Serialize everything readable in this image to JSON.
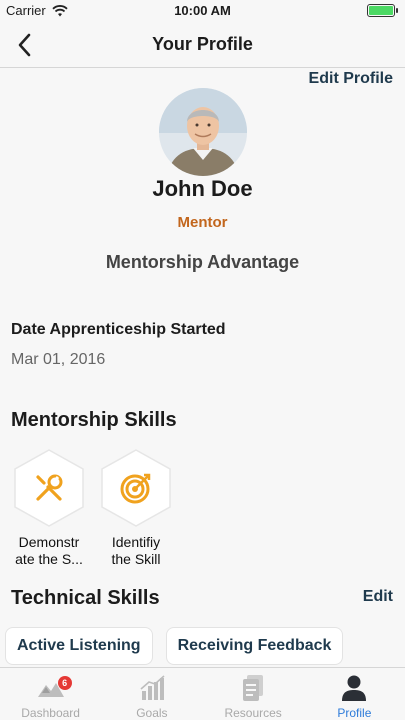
{
  "status_bar": {
    "carrier": "Carrier",
    "time": "10:00 AM",
    "battery_level": 1.0
  },
  "nav": {
    "title": "Your Profile",
    "back_icon": "chevron-left-icon"
  },
  "profile": {
    "edit_label": "Edit Profile",
    "name": "John Doe",
    "role": "Mentor",
    "subtitle": "Mentorship Advantage",
    "date_label": "Date Apprenticeship Started",
    "date_value": "Mar 01, 2016"
  },
  "mentorship_skills": {
    "title": "Mentorship Skills",
    "items": [
      {
        "label_line1": "Demonstr",
        "label_line2": "ate the S...",
        "icon": "tools-icon"
      },
      {
        "label_line1": "Identifiy",
        "label_line2": "the Skill",
        "icon": "target-icon"
      }
    ]
  },
  "technical_skills": {
    "title": "Technical Skills",
    "edit_label": "Edit",
    "chips": [
      "Active Listening",
      "Receiving Feedback"
    ]
  },
  "tab_bar": {
    "items": [
      {
        "label": "Dashboard",
        "icon": "mountain-icon",
        "badge": "6"
      },
      {
        "label": "Goals",
        "icon": "bar-chart-icon"
      },
      {
        "label": "Resources",
        "icon": "document-icon"
      },
      {
        "label": "Profile",
        "icon": "person-icon",
        "active": true
      }
    ]
  },
  "colors": {
    "accent_orange": "#c2661d",
    "skill_icon": "#f0a21e",
    "link_dark": "#1f3a4d",
    "tab_active": "#2d7bd9",
    "badge": "#e53935"
  }
}
